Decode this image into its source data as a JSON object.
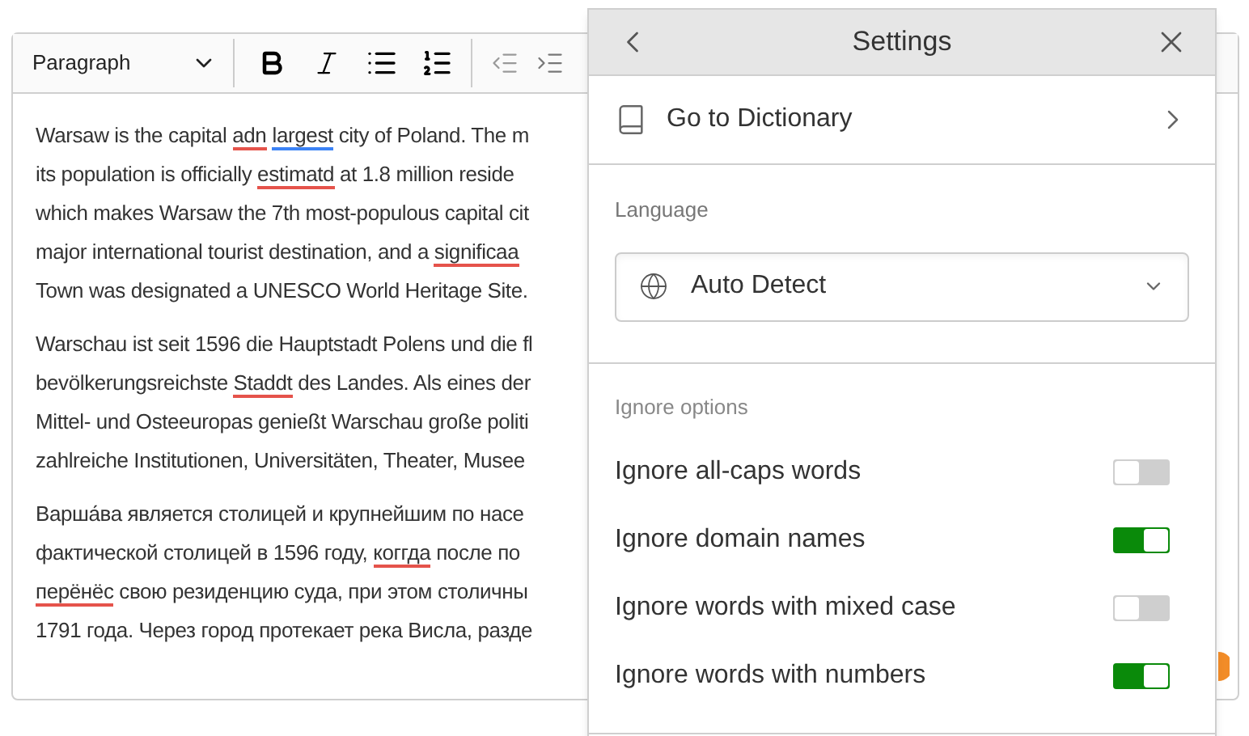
{
  "toolbar": {
    "block_format": "Paragraph"
  },
  "paragraphs": [
    {
      "lines": [
        [
          {
            "text": "Warsaw is the capital "
          },
          {
            "text": "adn",
            "color": "#e5534b"
          },
          {
            "text": "largest",
            "color": "#3b82f6"
          },
          {
            "text": " city of Poland. The m"
          }
        ],
        [
          {
            "text": "its population is officially "
          },
          {
            "text": "estimatd",
            "color": "#e5534b"
          },
          {
            "text": " at 1.8 million reside"
          }
        ],
        [
          {
            "text": "which makes Warsaw the 7th most-populous capital cit"
          }
        ],
        [
          {
            "text": "major international tourist destination, and a "
          },
          {
            "text": "significaa",
            "color": "#e5534b"
          }
        ],
        [
          {
            "text": "Town was designated a UNESCO World Heritage Site."
          }
        ]
      ]
    },
    {
      "lines": [
        [
          {
            "text": "Warschau ist seit 1596 die Hauptstadt Polens und die fl"
          }
        ],
        [
          {
            "text": "bevölkerungsreichste "
          },
          {
            "text": "Staddt",
            "color": "#e5534b"
          },
          {
            "text": " des Landes. Als eines der"
          }
        ],
        [
          {
            "text": "Mittel- und Osteeuropas genießt Warschau große politi"
          }
        ],
        [
          {
            "text": "zahlreiche Institutionen, Universitäten, Theater, Musee"
          }
        ]
      ]
    },
    {
      "lines": [
        [
          {
            "text": "Варша́ва является столицей и крупнейшим по насе"
          }
        ],
        [
          {
            "text": "фактической столицей в 1596 году, "
          },
          {
            "text": "коггда",
            "color": "#e5534b"
          },
          {
            "text": " после по"
          }
        ],
        [
          {
            "text": "перёнёс",
            "color": "#e5534b"
          },
          {
            "text": " свою резиденцию суда, при этом столичны"
          }
        ],
        [
          {
            "text": "1791 года. Через город протекает река Висла, разде"
          }
        ]
      ]
    }
  ],
  "settings": {
    "title": "Settings",
    "dictionary_link": "Go to Dictionary",
    "language": {
      "label": "Language",
      "value": "Auto Detect"
    },
    "ignore_options": {
      "label": "Ignore options",
      "toggles": [
        {
          "label": "Ignore all-caps words",
          "on": false
        },
        {
          "label": "Ignore domain names",
          "on": true
        },
        {
          "label": "Ignore words with mixed case",
          "on": false
        },
        {
          "label": "Ignore words with numbers",
          "on": true
        }
      ]
    }
  }
}
